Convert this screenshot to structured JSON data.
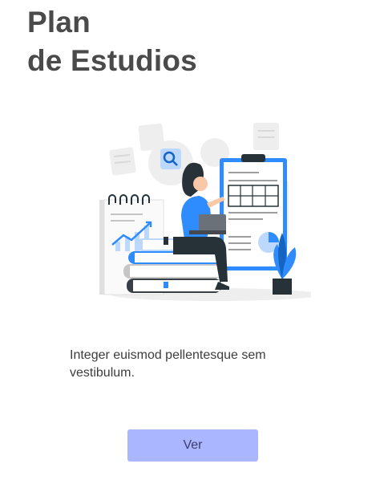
{
  "header": {
    "title_line1": "Plan",
    "title_line2": "de Estudios"
  },
  "content": {
    "description_line1": "Integer euismod pellentesque sem",
    "description_line2": "vestibulum."
  },
  "actions": {
    "view_label": "Ver"
  },
  "colors": {
    "accent": "#2e8cff",
    "button": "#aab6ff",
    "title": "#4a4a4a"
  },
  "illustration": {
    "icons": [
      "study-illustration",
      "search-icon",
      "plant-icon",
      "chart-icon"
    ]
  }
}
